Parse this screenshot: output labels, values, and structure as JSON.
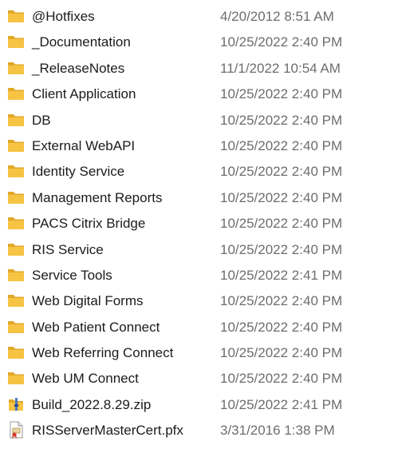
{
  "colors": {
    "folder": "#f6c343",
    "folder_dark": "#e2a829",
    "name_text": "#1b1b1b",
    "date_text": "#6d6d6d"
  },
  "files": [
    {
      "name": "@Hotfixes",
      "date": "4/20/2012 8:51 AM",
      "icon": "folder-icon"
    },
    {
      "name": "_Documentation",
      "date": "10/25/2022 2:40 PM",
      "icon": "folder-icon"
    },
    {
      "name": "_ReleaseNotes",
      "date": "11/1/2022 10:54 AM",
      "icon": "folder-icon"
    },
    {
      "name": "Client Application",
      "date": "10/25/2022 2:40 PM",
      "icon": "folder-icon"
    },
    {
      "name": "DB",
      "date": "10/25/2022 2:40 PM",
      "icon": "folder-icon"
    },
    {
      "name": "External WebAPI",
      "date": "10/25/2022 2:40 PM",
      "icon": "folder-icon"
    },
    {
      "name": "Identity Service",
      "date": "10/25/2022 2:40 PM",
      "icon": "folder-icon"
    },
    {
      "name": "Management Reports",
      "date": "10/25/2022 2:40 PM",
      "icon": "folder-icon"
    },
    {
      "name": "PACS Citrix Bridge",
      "date": "10/25/2022 2:40 PM",
      "icon": "folder-icon"
    },
    {
      "name": "RIS Service",
      "date": "10/25/2022 2:40 PM",
      "icon": "folder-icon"
    },
    {
      "name": "Service Tools",
      "date": "10/25/2022 2:41 PM",
      "icon": "folder-icon"
    },
    {
      "name": "Web Digital Forms",
      "date": "10/25/2022 2:40 PM",
      "icon": "folder-icon"
    },
    {
      "name": "Web Patient Connect",
      "date": "10/25/2022 2:40 PM",
      "icon": "folder-icon"
    },
    {
      "name": "Web Referring Connect",
      "date": "10/25/2022 2:40 PM",
      "icon": "folder-icon"
    },
    {
      "name": "Web UM Connect",
      "date": "10/25/2022 2:40 PM",
      "icon": "folder-icon"
    },
    {
      "name": "Build_2022.8.29.zip",
      "date": "10/25/2022 2:41 PM",
      "icon": "zip-archive-icon"
    },
    {
      "name": "RISServerMasterCert.pfx",
      "date": "3/31/2016 1:38 PM",
      "icon": "certificate-file-icon"
    }
  ]
}
